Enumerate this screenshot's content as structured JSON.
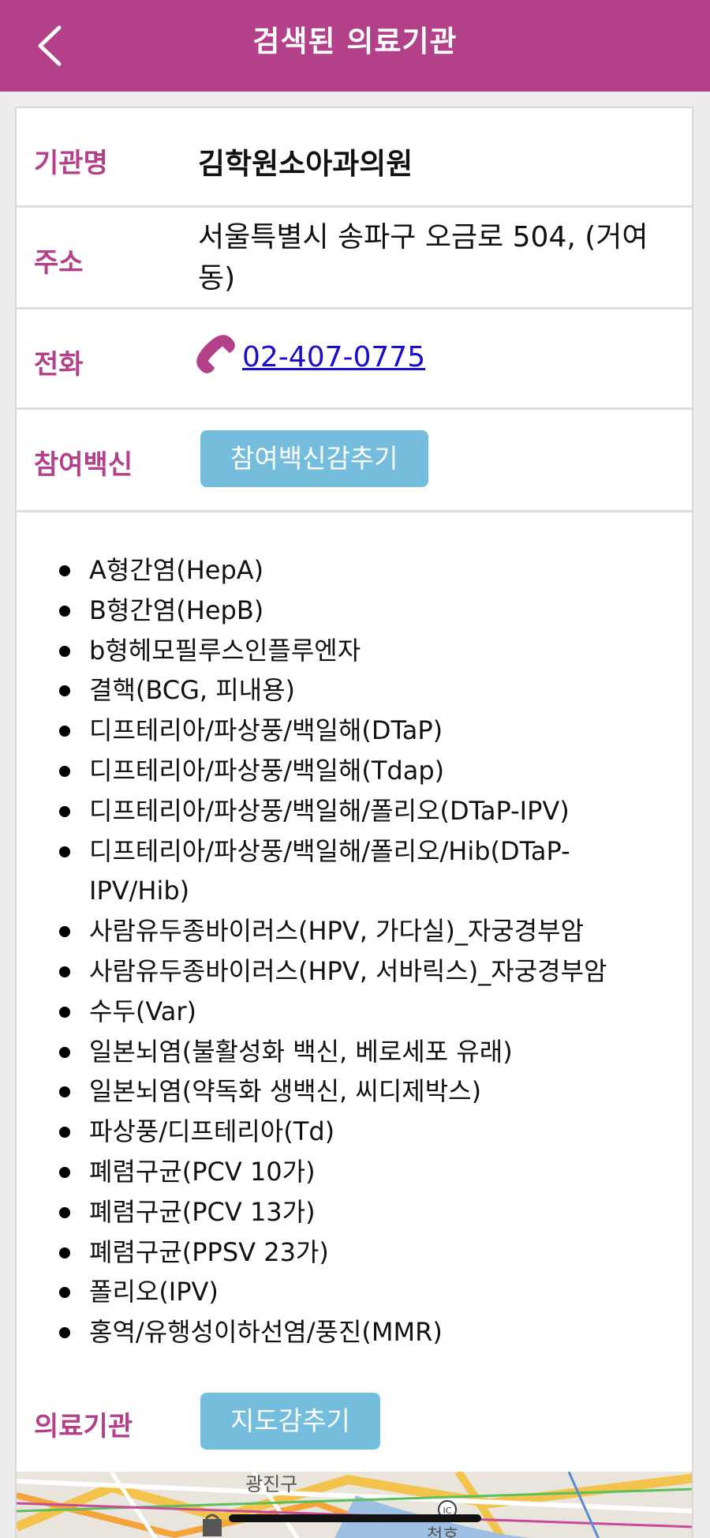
{
  "header": {
    "title": "검색된 의료기관",
    "back_icon": "chevron-left-icon"
  },
  "colors": {
    "brand": "#b3418a",
    "button": "#74bddc",
    "link": "#1a0dcc"
  },
  "info": {
    "name_label": "기관명",
    "name_value": "김학원소아과의원",
    "address_label": "주소",
    "address_value": "서울특별시 송파구 오금로 504, (거여동)",
    "phone_label": "전화",
    "phone_icon": "phone-icon",
    "phone_value": "02-407-0775",
    "vaccines_label": "참여백신",
    "vaccines_toggle": "참여백신감추기",
    "clinic_label": "의료기관",
    "map_toggle": "지도감추기"
  },
  "vaccines": [
    "A형간염(HepA)",
    "B형간염(HepB)",
    "b형헤모필루스인플루엔자",
    "결핵(BCG, 피내용)",
    "디프테리아/파상풍/백일해(DTaP)",
    "디프테리아/파상풍/백일해(Tdap)",
    "디프테리아/파상풍/백일해/폴리오(DTaP-IPV)",
    "디프테리아/파상풍/백일해/폴리오/Hib(DTaP-IPV/Hib)",
    "사람유두종바이러스(HPV, 가다실)_자궁경부암",
    "사람유두종바이러스(HPV, 서바릭스)_자궁경부암",
    "수두(Var)",
    "일본뇌염(불활성화 백신, 베로세포 유래)",
    "일본뇌염(약독화 생백신, 씨디제박스)",
    "파상풍/디프테리아(Td)",
    "폐렴구균(PCV 10가)",
    "폐렴구균(PCV 13가)",
    "폐렴구균(PPSV 23가)",
    "폴리오(IPV)",
    "홍역/유행성이하선염/풍진(MMR)"
  ],
  "map": {
    "labels": [
      "광진구",
      "천호"
    ]
  }
}
